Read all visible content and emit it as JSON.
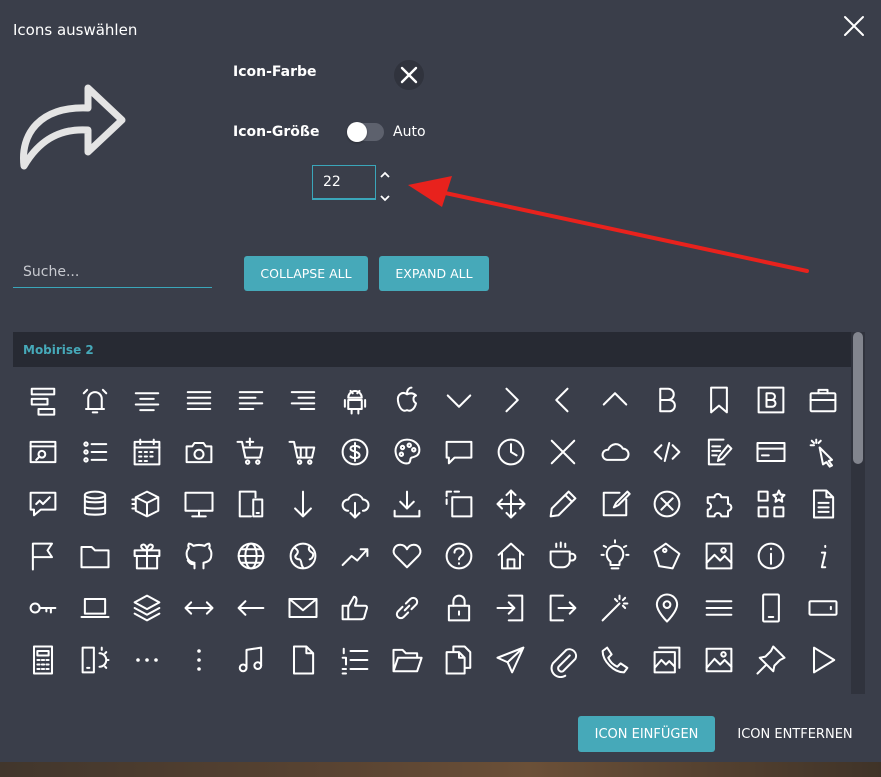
{
  "dialog": {
    "title": "Icons auswählen",
    "icon_color_label": "Icon-Farbe",
    "icon_size_label": "Icon-Größe",
    "auto_label": "Auto",
    "size_value": "22",
    "search_placeholder": "Suche...",
    "collapse_all": "COLLAPSE ALL",
    "expand_all": "EXPAND ALL",
    "insert_button": "ICON EINFÜGEN",
    "remove_button": "ICON ENTFERNEN"
  },
  "colors": {
    "background": "#3a3e4a",
    "accent": "#46a9b9",
    "annotation_arrow": "#e8221d"
  },
  "icon_set": {
    "name": "Mobirise 2",
    "icons": [
      "align-layers-icon",
      "alarm-bell-icon",
      "align-center-icon",
      "align-justify-icon",
      "align-left-icon",
      "align-right-icon",
      "android-icon",
      "apple-icon",
      "chevron-down-icon",
      "chevron-right-icon",
      "chevron-left-icon",
      "chevron-up-icon",
      "letter-b-icon",
      "bookmark-icon",
      "boxed-b-icon",
      "briefcase-icon",
      "browser-search-icon",
      "bullet-list-icon",
      "calendar-icon",
      "camera-icon",
      "cart-add-icon",
      "shopping-cart-icon",
      "dollar-coin-icon",
      "palette-icon",
      "speech-bubble-icon",
      "clock-icon",
      "close-x-icon",
      "cloud-icon",
      "code-icon",
      "edit-document-icon",
      "credit-card-icon",
      "cursor-click-icon",
      "chart-chat-icon",
      "database-icon",
      "cube-icon",
      "desktop-icon",
      "mobile-desktop-icon",
      "arrow-down-icon",
      "cloud-download-icon",
      "download-tray-icon",
      "dashed-square-icon",
      "move-arrows-icon",
      "pencil-icon",
      "edit-square-icon",
      "circle-x-icon",
      "puzzle-icon",
      "grid-star-icon",
      "file-icon",
      "flag-icon",
      "folder-icon",
      "gift-icon",
      "github-icon",
      "globe-icon",
      "planet-icon",
      "trending-up-icon",
      "heart-icon",
      "help-circle-icon",
      "home-icon",
      "coffee-cup-icon",
      "lightbulb-icon",
      "tag-icon",
      "picture-icon",
      "info-circle-icon",
      "info-italic-icon",
      "key-icon",
      "laptop-icon",
      "layers-icon",
      "arrows-horizontal-icon",
      "arrow-left-icon",
      "envelope-icon",
      "thumbs-up-icon",
      "chain-link-icon",
      "padlock-icon",
      "login-icon",
      "logout-icon",
      "magic-wand-icon",
      "map-pin-icon",
      "menu-lines-icon",
      "phone-outline-icon",
      "tablet-outline-icon",
      "calculator-phone-icon",
      "sun-frame-icon",
      "dots-horizontal-icon",
      "dots-vertical-icon",
      "music-note-icon",
      "blank-file-icon",
      "numbered-list-icon",
      "open-folder-icon",
      "copy-files-icon",
      "paper-plane-icon",
      "paperclip-icon",
      "phone-handset-icon",
      "image-gallery-icon",
      "image-icon",
      "pushpin-icon",
      "play-triangle-icon"
    ]
  }
}
